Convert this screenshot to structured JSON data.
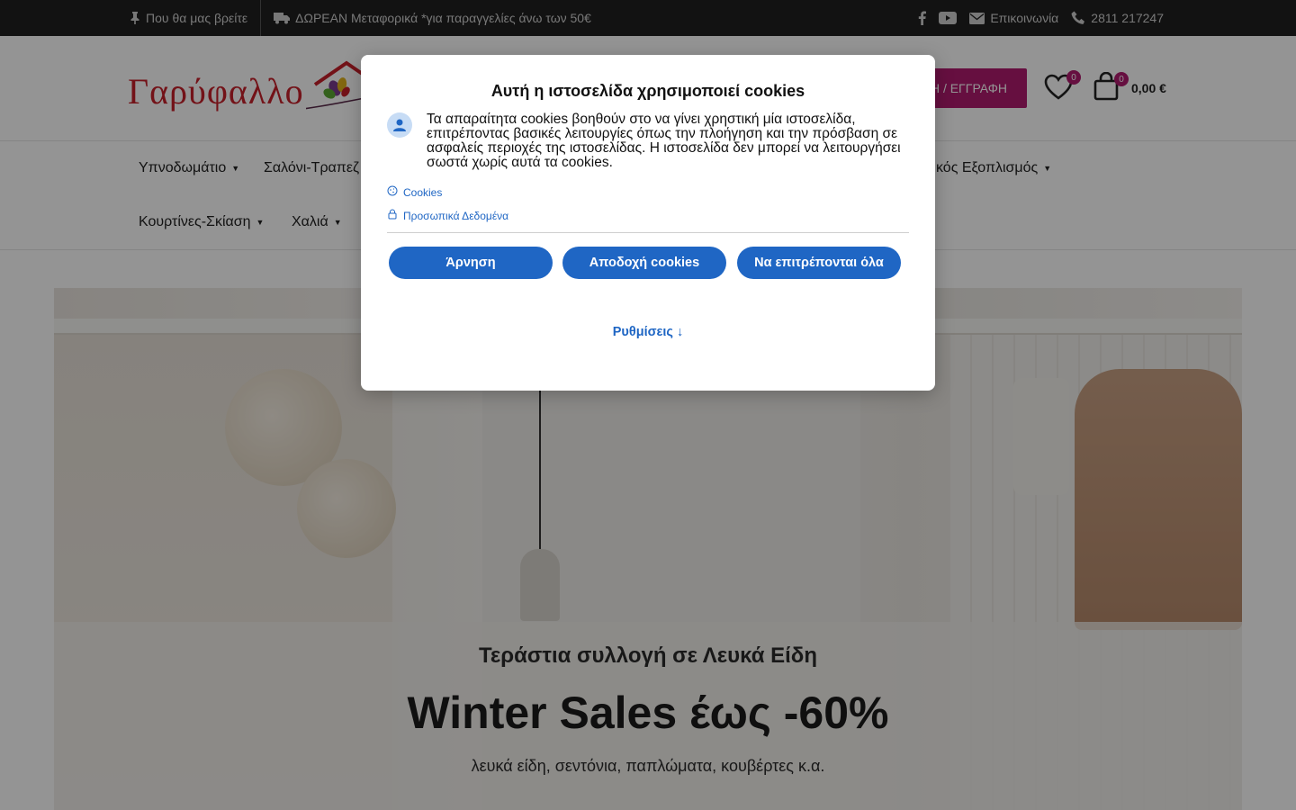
{
  "topbar": {
    "location": "Που θα μας βρείτε",
    "shipping": "ΔΩΡΕΑΝ Μεταφορικά *για παραγγελίες άνω των 50€",
    "contact": "Επικοινωνία",
    "phone": "2811 217247",
    "social": [
      "facebook-icon",
      "youtube-icon"
    ]
  },
  "header": {
    "logo_text": "Γαρύφαλλο",
    "login_label": "Η / ΕΓΓΡΑΦΗ",
    "wishlist_count": "0",
    "cart_count": "0",
    "cart_total": "0,00 €",
    "accent_color": "#b01a6e",
    "brand_color": "#c6202a"
  },
  "nav": {
    "items": [
      {
        "label": "Υπνοδωμάτιο"
      },
      {
        "label": "Σαλόνι-Τραπεζ"
      },
      {
        "label": "κός Εξοπλισμός"
      },
      {
        "label": "Κουρτίνες-Σκίαση"
      },
      {
        "label": "Χαλιά"
      }
    ]
  },
  "hero": {
    "subtitle": "Τεράστια συλλογή σε Λευκά Είδη",
    "title": "Winter Sales έως -60%",
    "description": "λευκά είδη, σεντόνια, παπλώματα, κουβέρτες κ.α."
  },
  "cookie_modal": {
    "title": "Αυτή η ιστοσελίδα χρησιμοποιεί cookies",
    "body": "Τα απαραίτητα cookies βοηθούν στο να γίνει χρηστική μία ιστοσελίδα, επιτρέποντας βασικές λειτουργίες όπως την πλοήγηση και την πρόσβαση σε ασφαλείς περιοχές της ιστοσελίδας. Η ιστοσελίδα δεν μπορεί να λειτουργήσει σωστά χωρίς αυτά τα cookies.",
    "link_cookies": "Cookies",
    "link_privacy": "Προσωπικά Δεδομένα",
    "btn_deny": "Άρνηση",
    "btn_accept": "Αποδοχή cookies",
    "btn_allow_all": "Να επιτρέπονται όλα",
    "settings": "Ρυθμίσεις ↓",
    "button_color": "#1f66c4"
  }
}
